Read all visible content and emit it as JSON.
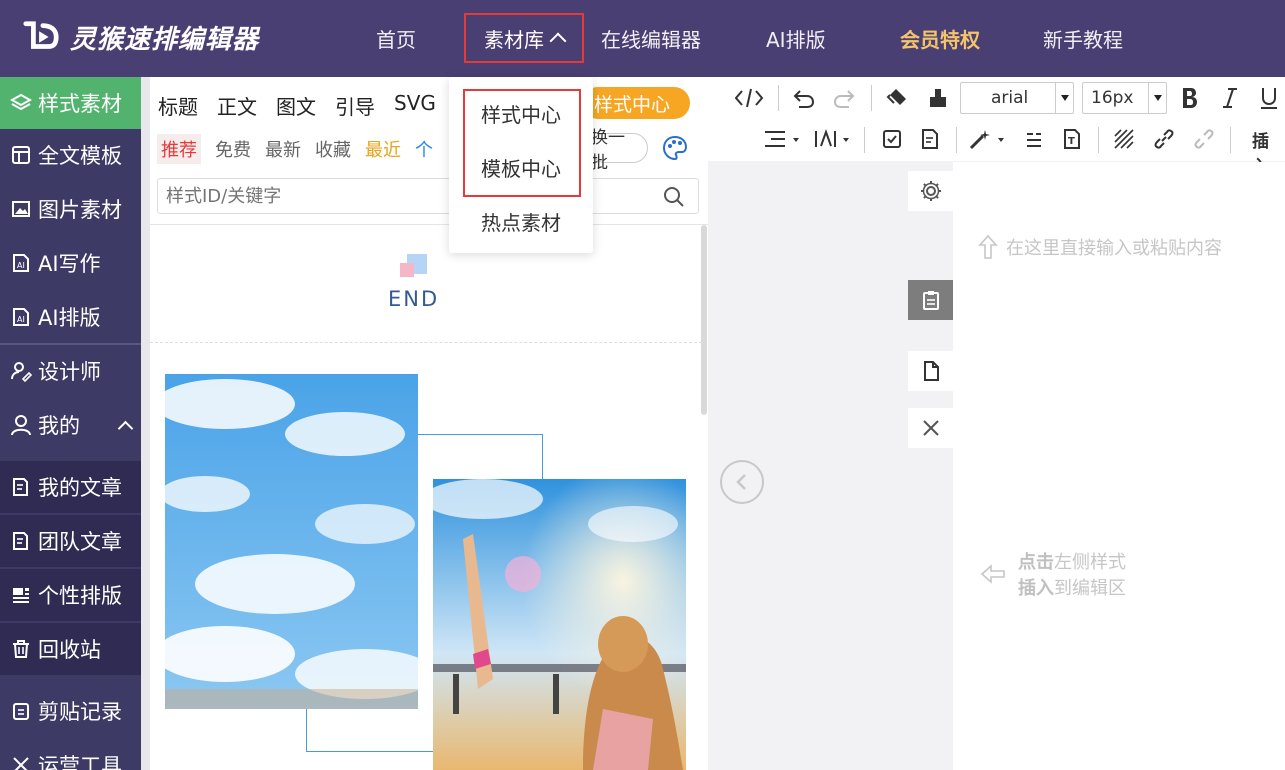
{
  "header": {
    "logo_text": "灵猴速排编辑器",
    "nav": {
      "home": "首页",
      "library": "素材库",
      "online_editor": "在线编辑器",
      "ai_layout": "AI排版",
      "vip": "会员特权",
      "tutorial": "新手教程"
    }
  },
  "library_menu": {
    "items": [
      "样式中心",
      "模板中心",
      "热点素材"
    ]
  },
  "sidebar": {
    "items": [
      {
        "label": "样式素材"
      },
      {
        "label": "全文模板"
      },
      {
        "label": "图片素材"
      },
      {
        "label": "AI写作"
      },
      {
        "label": "AI排版"
      },
      {
        "label": "设计师"
      },
      {
        "label": "我的"
      },
      {
        "label": "我的文章"
      },
      {
        "label": "团队文章"
      },
      {
        "label": "个性排版"
      },
      {
        "label": "回收站"
      },
      {
        "label": "剪贴记录"
      },
      {
        "label": "运营工具"
      }
    ]
  },
  "style_panel": {
    "tabs": [
      "标题",
      "正文",
      "图文",
      "引导",
      "SVG"
    ],
    "style_center_pill": "样式中心",
    "filters": [
      "推荐",
      "免费",
      "最新",
      "收藏",
      "最近",
      "个"
    ],
    "refresh_button": "换一批",
    "search_placeholder": "样式ID/关键字",
    "end_label": "END"
  },
  "toolbar": {
    "font": "arial",
    "size": "16px",
    "insert_label": "插入"
  },
  "editor": {
    "hint_top": "在这里直接输入或粘贴内容",
    "hint_click": "点击",
    "hint_click_rest": "左侧样式",
    "hint_insert": "插入",
    "hint_insert_rest": "到编辑区"
  },
  "colors": {
    "header_bg": "#493f73",
    "sidebar_bg": "#3e3a66",
    "active_green": "#52b36f",
    "vip_gold": "#f4c46a",
    "highlight_red": "#e53a3a",
    "pill_orange": "#f6a623"
  }
}
